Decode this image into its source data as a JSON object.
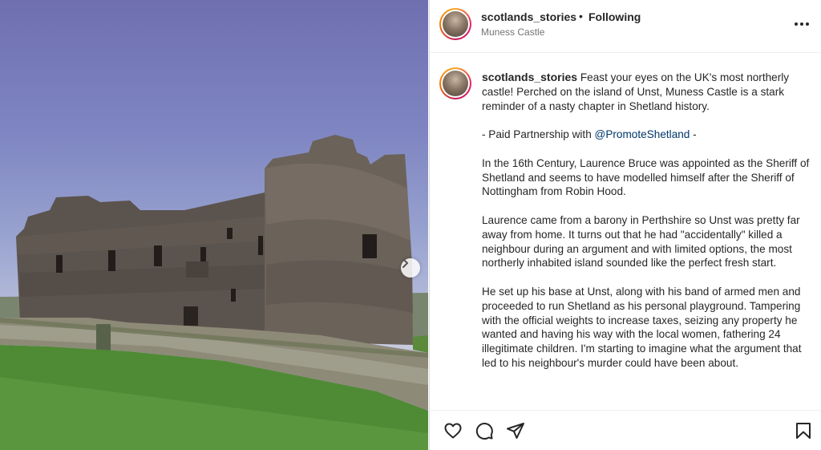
{
  "post": {
    "username": "scotlands_stories",
    "follow_status": "Following",
    "separator": "•",
    "location": "Muness Castle",
    "image_alt": "Muness Castle ruins"
  },
  "caption": {
    "username": "scotlands_stories",
    "intro": "Feast your eyes on the UK's most northerly castle! Perched on the island of Unst, Muness Castle is a stark reminder of a nasty chapter in Shetland history.",
    "partnership_prefix": "- Paid Partnership with ",
    "partnership_mention": "@PromoteShetland",
    "partnership_suffix": " -",
    "paragraph_1": "In the 16th Century, Laurence Bruce was appointed as the Sheriff of Shetland and seems to have modelled himself after the Sheriff of Nottingham from Robin Hood.",
    "paragraph_2": "Laurence came from a barony in Perthshire so Unst was pretty far away from home. It turns out that he had \"accidentally\" killed a neighbour during an argument and with limited options, the most northerly inhabited island sounded like the perfect fresh start.",
    "paragraph_3": "He set up his base at Unst, along with his band of armed men and proceeded to run Shetland as his personal playground. Tampering with the official weights to increase taxes, seizing any property he wanted and having his way with the local women, fathering 24 illegitimate children. I'm starting to imagine what the argument that led to his neighbour's murder could have been about."
  },
  "icons": {
    "like": "heart-icon",
    "comment": "comment-icon",
    "share": "share-icon",
    "save": "bookmark-icon",
    "more": "more-options-icon",
    "next": "chevron-right-icon"
  },
  "colors": {
    "text": "#262626",
    "secondary": "#737373",
    "mention": "#00376b"
  }
}
